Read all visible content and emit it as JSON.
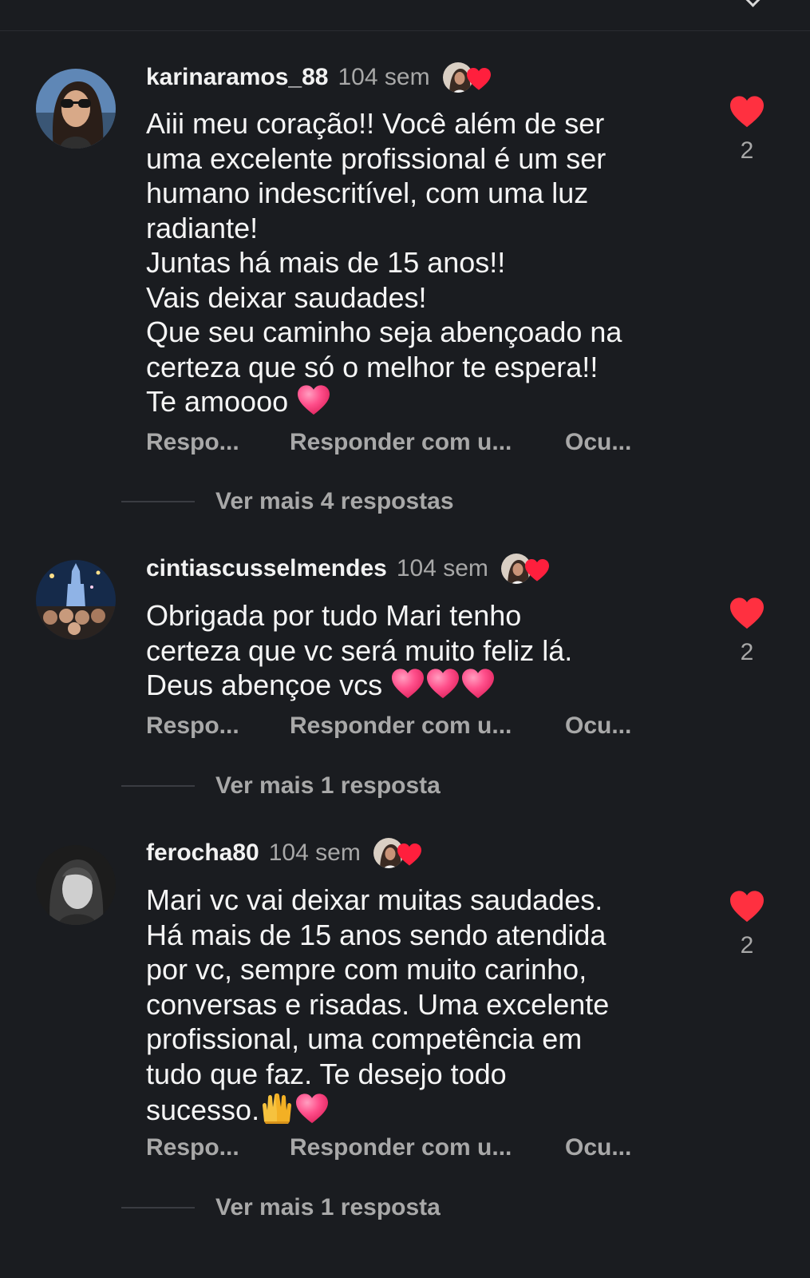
{
  "header": {
    "chevron_icon": "chevron-down-icon"
  },
  "colors": {
    "background": "#1a1c20",
    "like_red": "#ff3040",
    "emoji_pink": "#ff4f8b",
    "muted_text": "#a8a8a8"
  },
  "comments": [
    {
      "username": "karinaramos_88",
      "time": "104 sem",
      "text": "Aiii meu coração!! Você além de ser\numa excelente profissional é um ser\nhumano indescritível, com uma luz\nradiante!\nJuntas há mais de 15 anos!!\nVais deixar saudades!\nQue seu caminho seja abençoado na\ncerteza que só o melhor te espera!!\nTe amoooo",
      "emojis": [
        "pink-heart"
      ],
      "like_count": "2",
      "actions": {
        "reply": "Respo...",
        "reply_with": "Responder com u...",
        "hide": "Ocu..."
      },
      "view_more": "Ver mais 4 respostas"
    },
    {
      "username": "cintiascusselmendes",
      "time": "104 sem",
      "text": "Obrigada por tudo Mari tenho\ncerteza que vc será muito feliz lá.\nDeus abençoe vcs",
      "emojis": [
        "pink-heart",
        "pink-heart",
        "pink-heart"
      ],
      "like_count": "2",
      "actions": {
        "reply": "Respo...",
        "reply_with": "Responder com u...",
        "hide": "Ocu..."
      },
      "view_more": "Ver mais 1 resposta"
    },
    {
      "username": "ferocha80",
      "time": "104 sem",
      "text": "Mari vc vai deixar muitas saudades.\nHá  mais de 15 anos sendo atendida\npor vc, sempre com muito  carinho,\nconversas e risadas. Uma excelente\nprofissional, uma competência  em\ntudo que faz. Te desejo todo\nsucesso.",
      "emojis": [
        "raising-hands",
        "pink-heart"
      ],
      "like_count": "2",
      "actions": {
        "reply": "Respo...",
        "reply_with": "Responder com u...",
        "hide": "Ocu..."
      },
      "view_more": "Ver mais 1 resposta"
    }
  ]
}
